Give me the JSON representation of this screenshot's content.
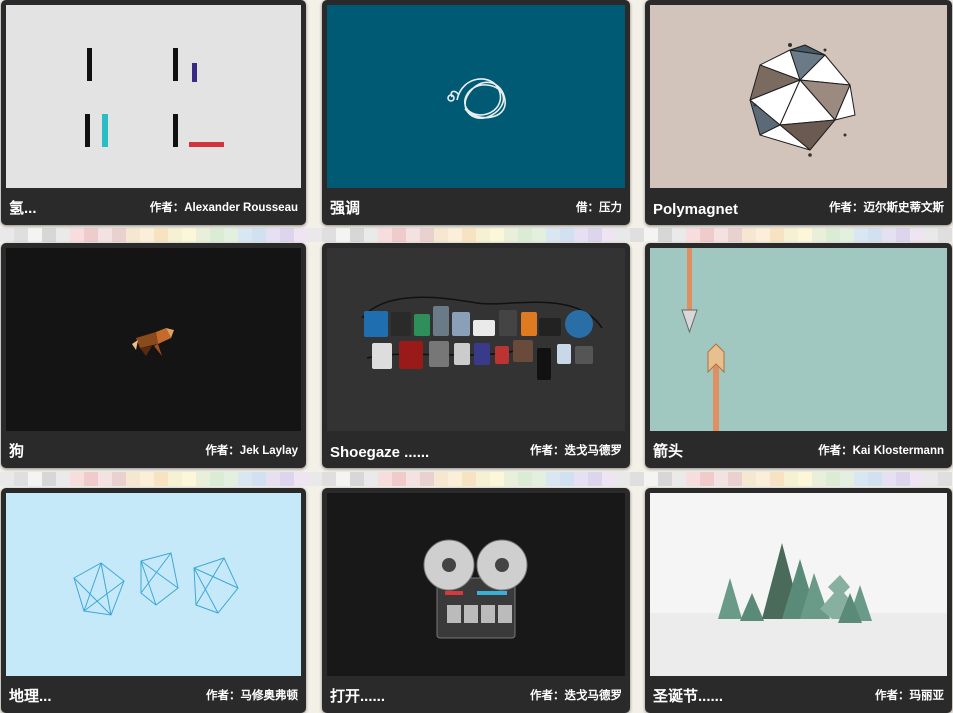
{
  "cards": [
    {
      "title": "氢...",
      "author": "作者：Alexander Rousseau",
      "thumb_color": "#e3e3e3"
    },
    {
      "title": "强调",
      "author": "借：压力",
      "thumb_color": "#005a74"
    },
    {
      "title": "Polymagnet",
      "author": "作者：迈尔斯史蒂文斯",
      "thumb_color": "#d2c4bb"
    },
    {
      "title": "狗",
      "author": "作者：Jek Laylay",
      "thumb_color": "#141414"
    },
    {
      "title": "Shoegaze ......",
      "author": "作者：迭戈马德罗",
      "thumb_color": "#333333"
    },
    {
      "title": "箭头",
      "author": "作者：Kai Klostermann",
      "thumb_color": "#a1c8c0"
    },
    {
      "title": "地理...",
      "author": "作者：马修奥弗顿",
      "thumb_color": "#c5e9f8"
    },
    {
      "title": "打开......",
      "author": "作者：迭戈马德罗",
      "thumb_color": "#181818"
    },
    {
      "title": "圣诞节......",
      "author": "作者：玛丽亚",
      "thumb_color": "#f5f5f5"
    }
  ],
  "icons": {
    "card_1": "hydrogen-bars-artwork",
    "card_2": "tangled-cable-artwork",
    "card_3": "polygon-sphere-artwork",
    "card_4": "low-poly-dog-artwork",
    "card_5": "guitar-pedals-artwork",
    "card_6": "arrow-artwork",
    "card_7": "wireframe-gems-artwork",
    "card_8": "reel-to-reel-tape-artwork",
    "card_9": "christmas-trees-artwork"
  }
}
